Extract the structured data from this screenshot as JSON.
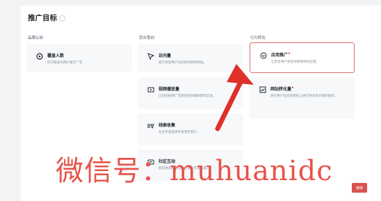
{
  "page": {
    "title": "推广目标",
    "continue_label": "继续"
  },
  "categories": {
    "brand": "品牌认知",
    "consider": "受众意向",
    "action": "行为转化"
  },
  "cards": {
    "reach": {
      "title": "覆盖人数",
      "desc": "向可能多的用户展示广告",
      "icon": "reach-icon"
    },
    "traffic": {
      "title": "访问量",
      "desc": "吸引更多用户访问你的目标网站。",
      "icon": "cursor-icon"
    },
    "app_promo": {
      "title": "应用推广",
      "desc": "让更多用户安装并使用你的应用。",
      "icon": "app-icon",
      "badge": "•"
    },
    "video_views": {
      "title": "视频播放量",
      "desc": "让您的视频广告获得更多播放量和互动。",
      "icon": "video-icon"
    },
    "web_conversion": {
      "title": "网站转化量",
      "desc": "吸引用户在您的网站上执行更多有价值的操作。",
      "icon": "chart-icon",
      "badge": "•"
    },
    "lead_gen": {
      "title": "线索收集",
      "desc": "为业务或品牌开发潜在客户。",
      "icon": "lead-icon"
    },
    "community": {
      "title": "社区互动",
      "desc": "获得更多粉丝与关注或主页访问量。",
      "icon": "community-icon"
    }
  },
  "watermark": "微信号：muhuanidc",
  "colors": {
    "selected_border": "#e06a6a",
    "arrow": "#e0302a",
    "watermark": "#e8534b",
    "button": "#d9534f"
  }
}
